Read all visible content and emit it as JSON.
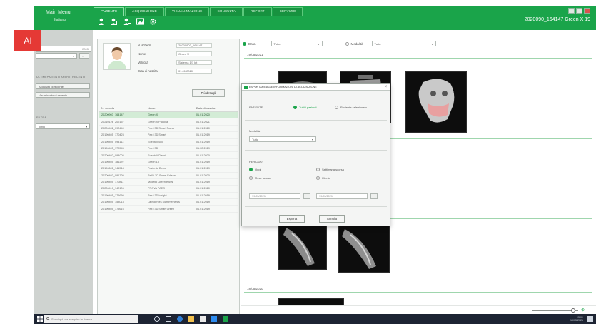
{
  "header": {
    "menu_title": "Main Menu",
    "menu_sub": "Italiano",
    "tabs": [
      "PAZIENTE",
      "ACQUISIZIONE",
      "VISUALIZZAZIONE",
      "CONSULTA",
      "REPORT",
      "SERVIZIO"
    ],
    "patient_title": "2020090_164147 Green X 19"
  },
  "badge": {
    "label": "AI"
  },
  "sidebar": {
    "search_value": "2005",
    "section_recent": "ULTIMI PAZIENTI APERTI RECENTI",
    "btn_recent1": "Acquisito di recente",
    "btn_recent2": "Visualizzato di recente",
    "section_filter": "FILTRA",
    "filter_value": "Tutto",
    "add_label": "+",
    "btn_small": "..."
  },
  "patient": {
    "fields": [
      {
        "label": "N. scheda",
        "value": "20200903_164147"
      },
      {
        "label": "Nome",
        "value": "Green X"
      },
      {
        "label": "Velocità",
        "value": "Sistema 1/1 kit"
      },
      {
        "label": "Data di nascita",
        "value": "01.01.2020"
      }
    ],
    "details_button": "Più dettagli",
    "table": {
      "headers": [
        "N. scheda",
        "Nome",
        "Data di nascita"
      ],
      "rows": [
        [
          "20200903_164147",
          "Green X",
          "01.01.2020"
        ],
        [
          "20210126_202157",
          "Green X Padova",
          "01.01.2021"
        ],
        [
          "20200402_092440",
          "Pax i 3D Smart Roma",
          "01.01.2020"
        ],
        [
          "20190405_170423",
          "Pax i 3D Smart",
          "01.01.2019"
        ],
        [
          "20190405_094113",
          "Edentuli 400",
          "01.01.2019"
        ],
        [
          "20190405_170545",
          "Pax i 3D",
          "01.02.2019"
        ],
        [
          "20200402_094005",
          "Edentuli Classi",
          "01.01.2020"
        ],
        [
          "20190405_181129",
          "Green 18",
          "01.01.2019"
        ],
        [
          "20190601_141514",
          "Paziente Demo",
          "01.01.2019"
        ],
        [
          "20200403_091720",
          "PaX i 3D Smart Edison",
          "01.01.2020"
        ],
        [
          "20190405_170811",
          "Modello Green e 60s",
          "01.01.2019"
        ],
        [
          "20200410_142106",
          "PROVA PAEO",
          "01.01.2020"
        ],
        [
          "20190405_175650",
          "Pax i 3D Insight",
          "01.01.2019"
        ],
        [
          "20190405_153013",
          "Lapsdentes Marrimelheras",
          "01.01.2019"
        ],
        [
          "20190405_175616",
          "Pax i 3D Smart Green",
          "01.01.2019"
        ]
      ]
    }
  },
  "filters": {
    "radio_date": "Data",
    "select1": "Tutto",
    "radio_modality": "Modalità",
    "select2": "Tutto"
  },
  "sections": {
    "date1": "19/05/2021",
    "date2": "18/05/2020"
  },
  "dialog": {
    "title": "ESPORTARE ALLE INFORMAZIONI DI ACQUISIZIONE",
    "patient_label": "PAZIENTE",
    "radio_all": "Tutti i pazienti",
    "radio_selected": "Paziente selezionato",
    "modality_label": "Modalità",
    "modality_value": "Tutto",
    "period_label": "PERIODO",
    "opt_today": "Oggi",
    "opt_week": "Settimana scorsa",
    "opt_month": "Mese scorso",
    "opt_custom": "Utente",
    "date_from": "19/05/2021",
    "date_to": "19/05/2021",
    "btn_ok": "Esporta",
    "btn_cancel": "Annulla"
  },
  "taskbar": {
    "search_placeholder": "Scrivi qui per eseguire la ricerca",
    "clock": "15:01",
    "date": "19/05/2021"
  }
}
